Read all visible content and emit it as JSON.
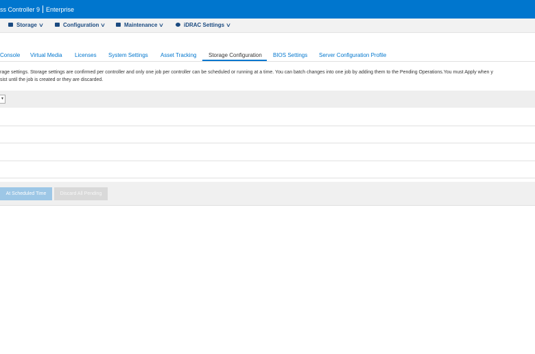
{
  "header": {
    "title": "ss Controller 9",
    "edition": "Enterprise"
  },
  "menu": [
    {
      "label": "Storage",
      "icon": "storage-icon"
    },
    {
      "label": "Configuration",
      "icon": "configuration-icon"
    },
    {
      "label": "Maintenance",
      "icon": "maintenance-icon"
    },
    {
      "label": "iDRAC Settings",
      "icon": "idrac-settings-icon"
    }
  ],
  "tabs": [
    {
      "label": "Console"
    },
    {
      "label": "Virtual Media"
    },
    {
      "label": "Licenses"
    },
    {
      "label": "System Settings"
    },
    {
      "label": "Asset Tracking"
    },
    {
      "label": "Storage Configuration"
    },
    {
      "label": "BIOS Settings"
    },
    {
      "label": "Server Configuration Profile"
    }
  ],
  "active_tab": "Storage Configuration",
  "notice": {
    "line1": "rage settings. Storage settings are confirmed per controller and only one job per controller can be scheduled or running at a time. You can batch changes into one job by adding them to the Pending Operations.You must Apply when y",
    "line2": "sist until the job is created or they are discarded."
  },
  "controller_select": {
    "arrow": "▼"
  },
  "actions": {
    "scheduled_label": "At Scheduled Time",
    "discard_label": "Discard All Pending"
  },
  "colors": {
    "brand": "#0076ce",
    "menu_text": "#1a4a80"
  }
}
